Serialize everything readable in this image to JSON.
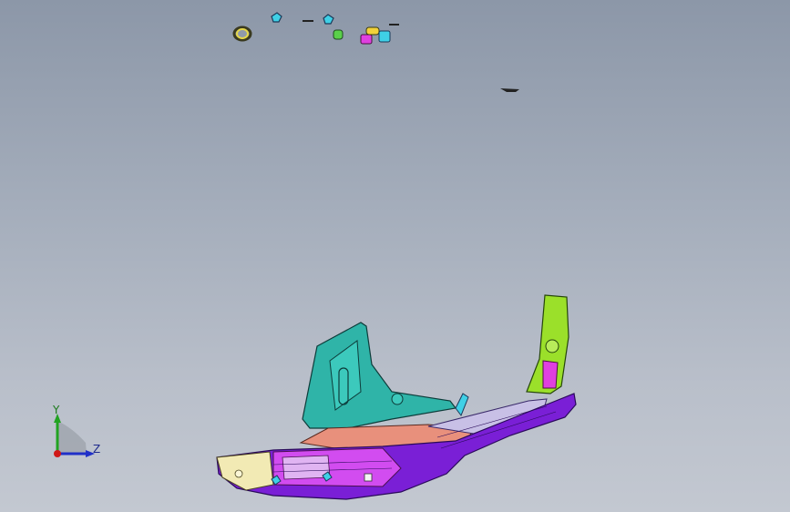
{
  "viewport": {
    "background_top": "#8c97a8",
    "background_bottom": "#c3c8d1"
  },
  "model": {
    "colors": {
      "purple": "#7a1fd6",
      "magenta": "#d24cf0",
      "teal": "#2fb4a8",
      "cyan": "#3fd0e6",
      "green": "#9be02a",
      "salmon": "#e8907c",
      "cream": "#f2eab4",
      "pink": "#e0b4f2"
    }
  },
  "triad": {
    "y_label": "Y",
    "z_label": "Z",
    "y_color": "#22a322",
    "z_color": "#2030c8",
    "x_color": "#d01818"
  }
}
